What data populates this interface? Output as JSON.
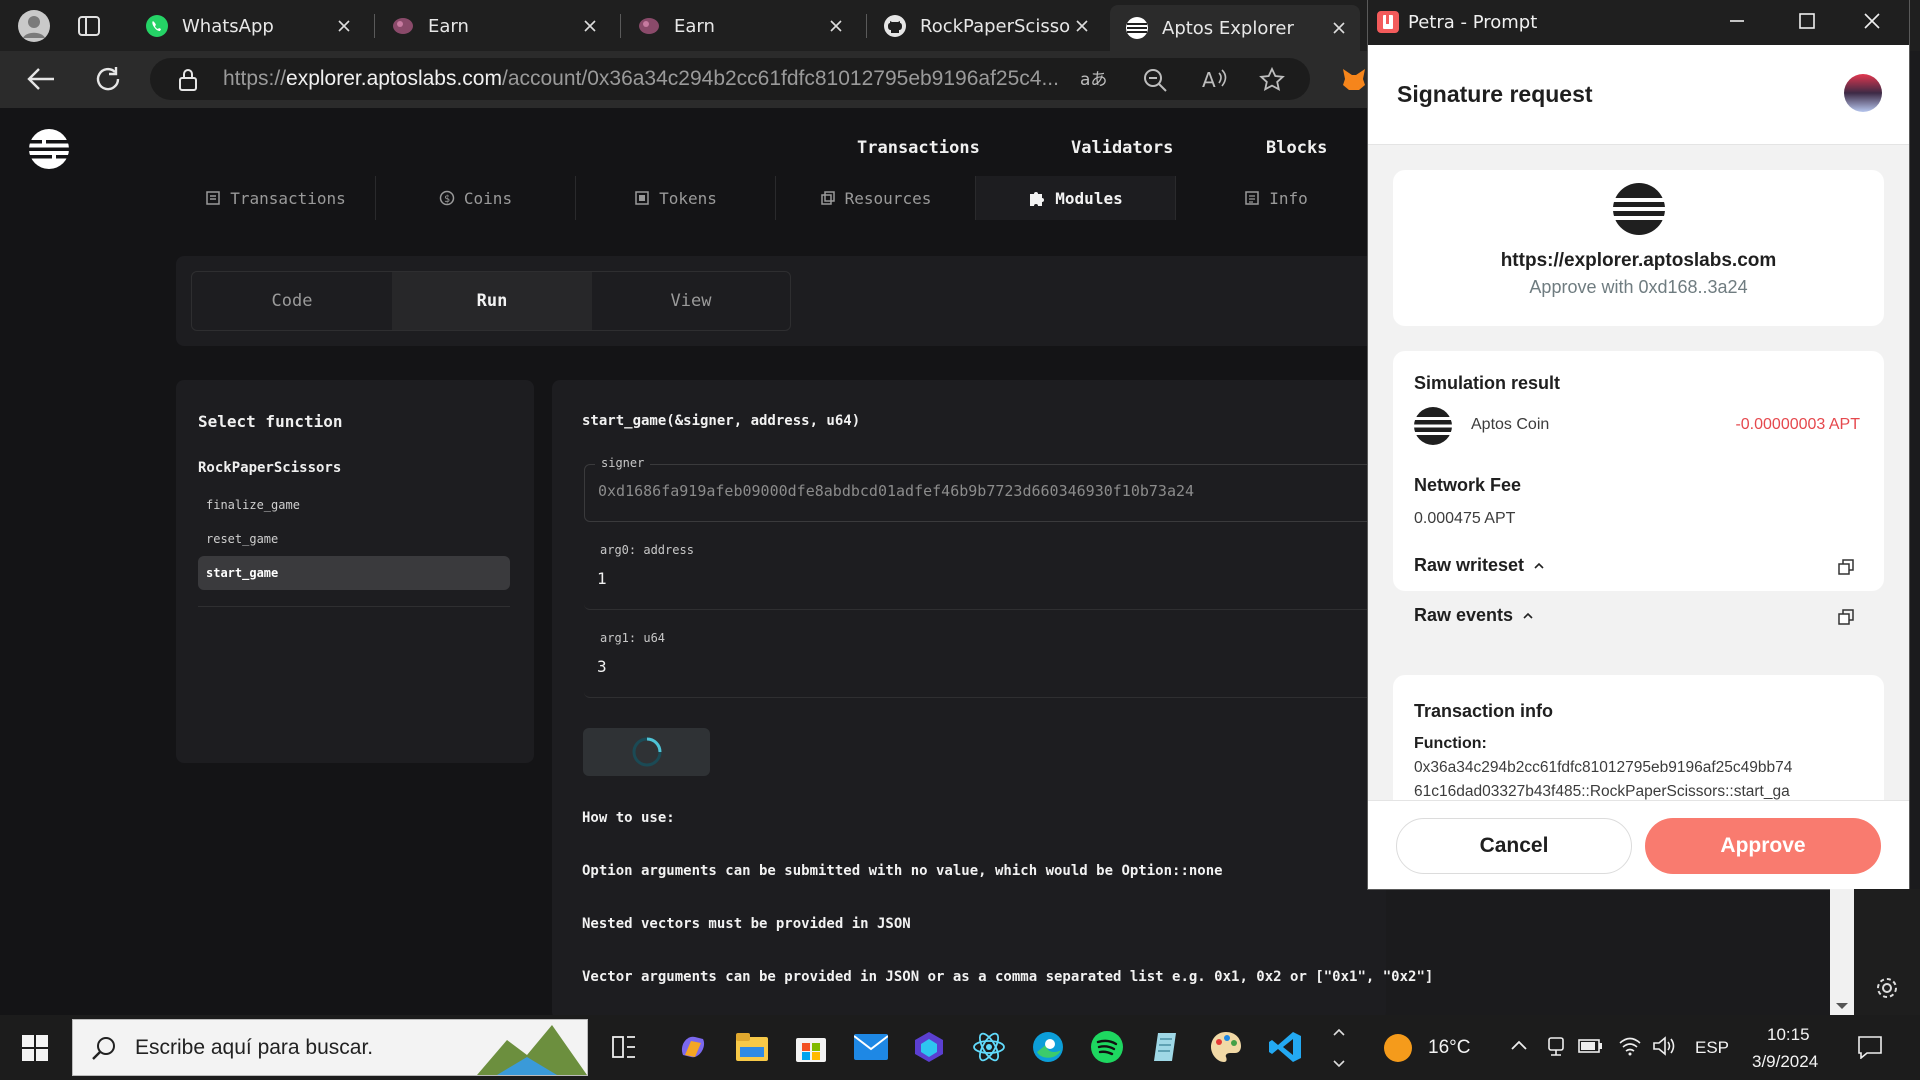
{
  "browser": {
    "tabs": [
      {
        "title": "WhatsApp",
        "icon": "whatsapp-icon",
        "active": false
      },
      {
        "title": "Earn",
        "icon": "earn-icon",
        "active": false
      },
      {
        "title": "Earn",
        "icon": "earn-icon",
        "active": false
      },
      {
        "title": "RockPaperScissors",
        "icon": "github-icon",
        "active": false
      },
      {
        "title": "Aptos Explorer",
        "icon": "aptos-icon",
        "active": true
      }
    ],
    "url_prefix": "https://",
    "url_host": "explorer.aptoslabs.com",
    "url_path": "/account/0x36a34c294b2cc61fdfc81012795eb9196af25c4..."
  },
  "explorer": {
    "nav": [
      "Transactions",
      "Validators",
      "Blocks"
    ],
    "subtabs": [
      {
        "label": "Transactions",
        "icon": "list-icon"
      },
      {
        "label": "Coins",
        "icon": "coin-icon"
      },
      {
        "label": "Tokens",
        "icon": "token-icon"
      },
      {
        "label": "Resources",
        "icon": "resources-icon"
      },
      {
        "label": "Modules",
        "icon": "puzzle-icon",
        "active": true
      },
      {
        "label": "Info",
        "icon": "info-icon"
      }
    ],
    "segments": [
      {
        "label": "Code"
      },
      {
        "label": "Run",
        "active": true
      },
      {
        "label": "View"
      }
    ],
    "select_function_title": "Select function",
    "module_name": "RockPaperScissors",
    "functions": [
      {
        "name": "finalize_game"
      },
      {
        "name": "reset_game"
      },
      {
        "name": "start_game",
        "selected": true
      }
    ],
    "signature": "start_game(&signer, address, u64)",
    "fields": [
      {
        "label": "signer",
        "value": "0xd1686fa919afeb09000dfe8abdbcd01adfef46b9b7723d660346930f10b73a24",
        "disabled": true
      },
      {
        "label": "arg0: address",
        "value": "1"
      },
      {
        "label": "arg1: u64",
        "value": "3"
      }
    ],
    "help": [
      "How to use:",
      "Option arguments can be submitted with no value, which would be Option::none",
      "Nested vectors must be provided in JSON",
      "Vector arguments can be provided in JSON or as a comma separated list e.g. 0x1, 0x2 or [\"0x1\", \"0x2\"]"
    ]
  },
  "petra": {
    "window_title": "Petra - Prompt",
    "heading": "Signature request",
    "origin": "https://explorer.aptoslabs.com",
    "approve_with": "Approve with 0xd168..3a24",
    "simulation_title": "Simulation result",
    "coin_name": "Aptos Coin",
    "coin_delta": "-0.00000003 APT",
    "network_fee_label": "Network Fee",
    "network_fee_value": "0.000475 APT",
    "raw_writeset": "Raw writeset",
    "raw_events": "Raw events",
    "tx_info_title": "Transaction info",
    "function_label": "Function:",
    "function_line1": "0x36a34c294b2cc61fdfc81012795eb9196af25c49bb74",
    "function_line2": "61c16dad03327b43f485::RockPaperScissors::start_ga",
    "cancel": "Cancel",
    "approve": "Approve",
    "colors": {
      "approve": "#f97b6f",
      "negative": "#e5484d"
    }
  },
  "taskbar": {
    "search_placeholder": "Escribe aquí para buscar.",
    "weather": "16°C",
    "language": "ESP",
    "time": "10:15",
    "date": "3/9/2024"
  }
}
